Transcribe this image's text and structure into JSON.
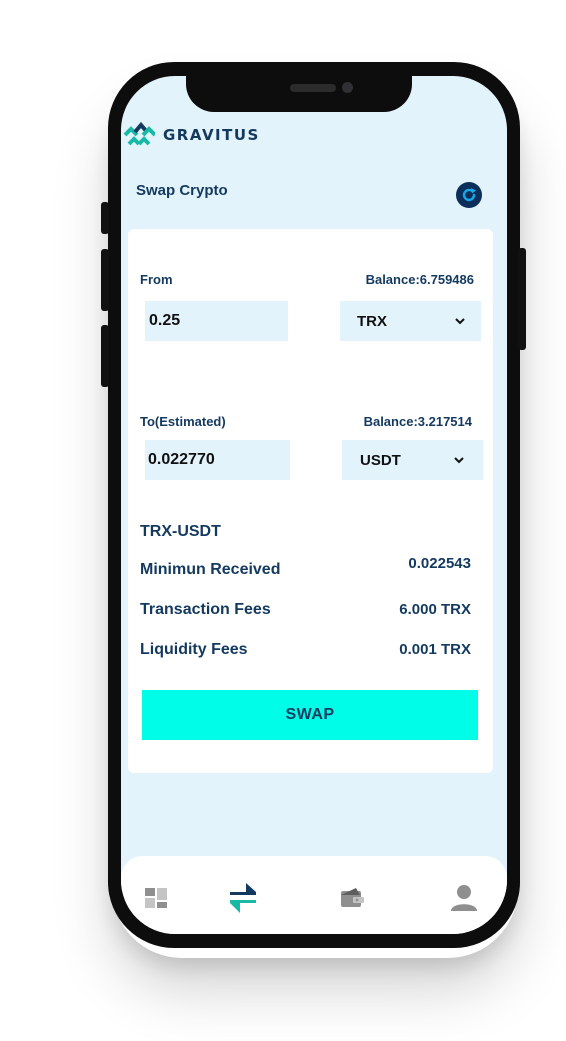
{
  "app": {
    "brand_name": "GRAVITUS",
    "page_title": "Swap Crypto"
  },
  "from": {
    "label": "From",
    "balance": "Balance:6.759486",
    "amount": "0.25",
    "token": "TRX"
  },
  "to": {
    "label": "To(Estimated)",
    "balance": "Balance:3.217514",
    "amount": "0.022770",
    "token": "USDT"
  },
  "summary": {
    "pair": "TRX-USDT",
    "rows": [
      {
        "label": "Minimun Received",
        "value": "0.022543"
      },
      {
        "label": "Transaction Fees",
        "value": "6.000 TRX"
      },
      {
        "label": "Liquidity Fees",
        "value": "0.001 TRX"
      }
    ]
  },
  "swap_label": "SWAP",
  "nav": [
    {
      "icon": "dashboard-icon",
      "active": false
    },
    {
      "icon": "swap-arrows-icon",
      "active": true
    },
    {
      "icon": "wallet-icon",
      "active": false
    },
    {
      "icon": "profile-icon",
      "active": false
    }
  ],
  "colors": {
    "screen_bg": "#e3f3fb",
    "navy": "#13395f",
    "accent_cyan": "#00fde8",
    "logo_teal": "#19b9a6"
  }
}
